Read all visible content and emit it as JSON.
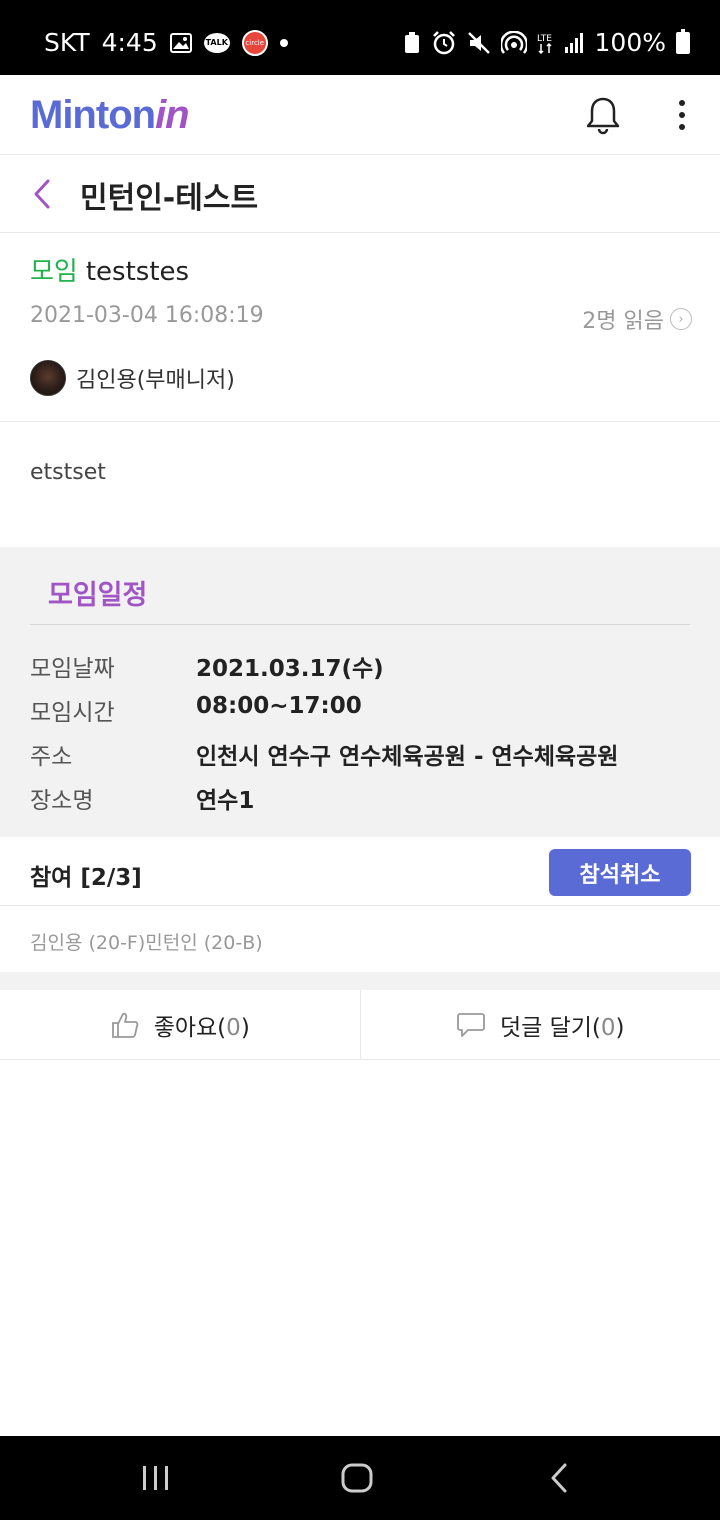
{
  "status_bar": {
    "carrier": "SKT",
    "time": "4:45",
    "talk_badge": "TALK",
    "battery": "100%",
    "network": "LTE"
  },
  "header": {
    "logo_text": "Minton",
    "logo_suffix": "in",
    "bell_icon": "bell-icon",
    "menu_icon": "more-vertical-icon"
  },
  "title_bar": {
    "title": "민턴인-테스트"
  },
  "post": {
    "type": "모임",
    "title": "teststes",
    "date": "2021-03-04 16:08:19",
    "reads": "2명 읽음",
    "author": "김인용(부매니저)",
    "body": "etstset"
  },
  "schedule": {
    "title": "모임일정",
    "rows": [
      {
        "label": "모임날짜",
        "value": "2021.03.17(수)"
      },
      {
        "label": "모임시간",
        "value": "08:00~17:00"
      },
      {
        "label": "주소",
        "value": "인천시 연수구 연수체육공원 - 연수체육공원"
      },
      {
        "label": "장소명",
        "value": "연수1"
      }
    ]
  },
  "participants": {
    "label": "참여 [2/3]",
    "cancel_label": "참석취소",
    "names": "김인용 (20-F)민턴인 (20-B)"
  },
  "actions": {
    "like_label": "좋아요(",
    "like_count": "0",
    "like_close": ")",
    "comment_label": "덧글 달기(",
    "comment_count": "0",
    "comment_close": ")"
  },
  "colors": {
    "brand_blue": "#5b6bd6",
    "brand_purple": "#a054c6",
    "type_green": "#22b24c"
  }
}
